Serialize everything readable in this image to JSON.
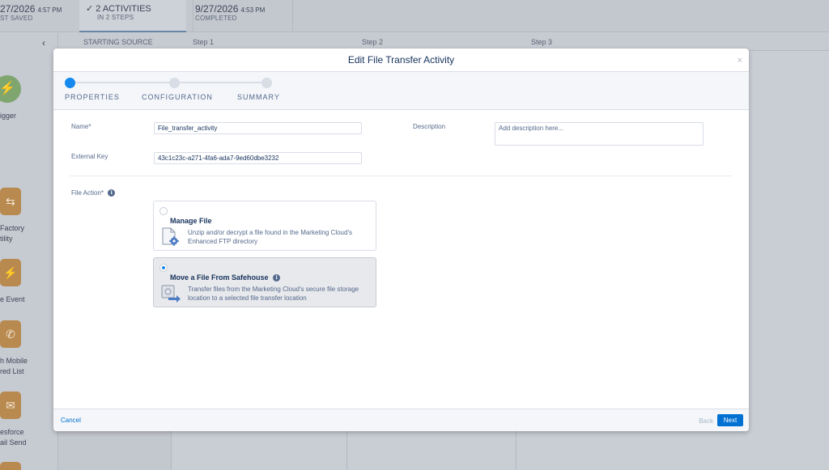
{
  "topbar": {
    "saved": {
      "date": "27/2026",
      "time": "4:57 PM",
      "label": "ST SAVED"
    },
    "activities": {
      "check": "✓",
      "title": "2 ACTIVITIES",
      "sub": "IN 2 STEPS"
    },
    "completed": {
      "date": "9/27/2026",
      "time": "4:53 PM",
      "label": "COMPLETED"
    }
  },
  "stepbar": {
    "back_chevron": "‹",
    "starting_source": "STARTING SOURCE",
    "steps": [
      "Step 1",
      "Step 2",
      "Step 3"
    ]
  },
  "sidebar": {
    "trigger_label": "igger",
    "items": [
      {
        "icon": "file-transfer-icon",
        "glyph": "⇆",
        "label_1": "Factory",
        "label_2": "tility"
      },
      {
        "icon": "bolt-icon",
        "glyph": "⚡",
        "label_1": "e Event",
        "label_2": ""
      },
      {
        "icon": "mobile-icon",
        "glyph": "✆",
        "label_1": "h Mobile",
        "label_2": "red List"
      },
      {
        "icon": "envelope-icon",
        "glyph": "✉",
        "label_1": "esforce",
        "label_2": "ail Send"
      }
    ]
  },
  "modal": {
    "title": "Edit File Transfer Activity",
    "close": "×",
    "wizard": [
      "PROPERTIES",
      "CONFIGURATION",
      "SUMMARY"
    ],
    "name_label": "Name*",
    "name_value": "File_transfer_activity",
    "external_key_label": "External Key",
    "external_key_value": "43c1c23c-a271-4fa6-ada7-9ed60dbe3232",
    "description_label": "Description",
    "description_placeholder": "Add description here...",
    "file_action_label": "File Action*",
    "info_glyph": "i",
    "options": [
      {
        "title": "Manage File",
        "desc": "Unzip and/or decrypt a file found in the Marketing Cloud's Enhanced FTP directory",
        "selected": false
      },
      {
        "title": "Move a File From Safehouse",
        "desc": "Transfer files from the Marketing Cloud's secure file storage location to a selected file transfer location",
        "selected": true
      }
    ],
    "footer": {
      "cancel": "Cancel",
      "back": "Back",
      "next": "Next"
    }
  },
  "colors": {
    "accent": "#0070d2",
    "wizard_active": "#1589ee",
    "modal_bg": "#ffffff"
  }
}
